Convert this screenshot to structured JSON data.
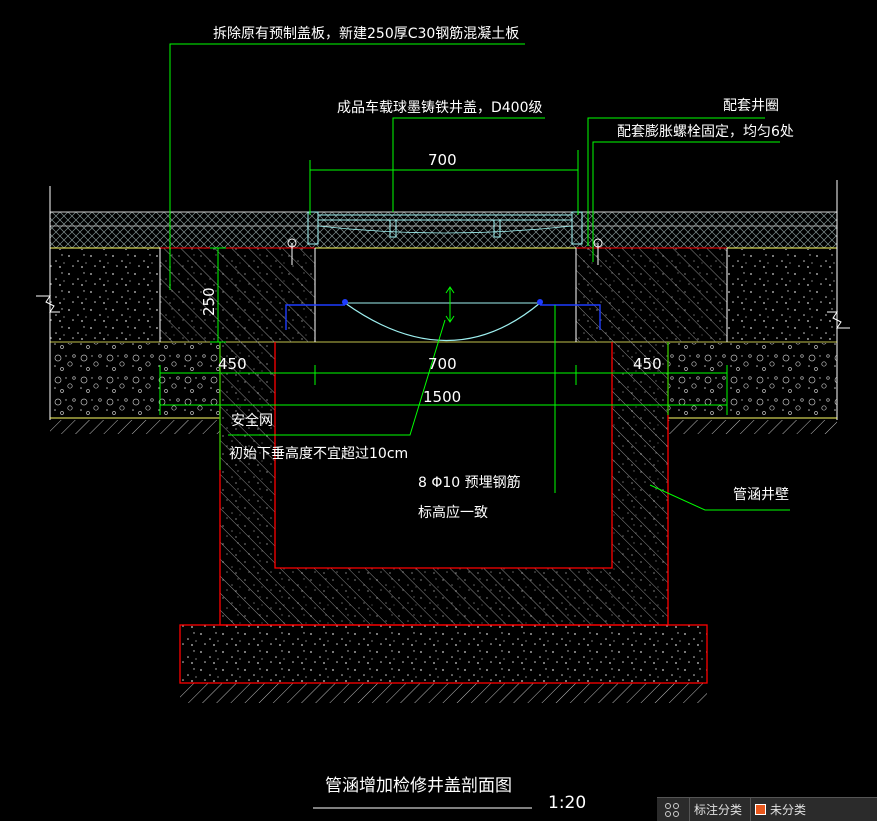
{
  "labels": {
    "demolish_note": "拆除原有预制盖板，新建250厚C30钢筋混凝土板",
    "cover_note": "成品车载球墨铸铁井盖，D400级",
    "ring_note": "配套井圈",
    "bolt_note": "配套膨胀螺栓固定，均匀6处",
    "safety_net": "安全网",
    "sag_note": "初始下垂高度不宜超过10cm",
    "rebar_note": "8 Φ10 预埋钢筋",
    "elevation_note": "标高应一致",
    "wall_note": "管涵井壁"
  },
  "dimensions": {
    "top_opening": "700",
    "slab_thickness": "250",
    "left_width": "450",
    "middle_width": "700",
    "right_width": "450",
    "total_width": "1500"
  },
  "title": {
    "text": "管涵增加检修井盖剖面图",
    "scale": "1:20"
  },
  "statusbar": {
    "annotation_label": "标注分类",
    "category_label": "未分类",
    "category_color": "#e8571c"
  },
  "colors": {
    "background": "#000000",
    "leader": "#00ff00",
    "outline_red": "#ff0000",
    "cover_cyan": "#9ef0f0",
    "rebar_blue": "#1e3cff",
    "pavement_yellow": "#ffff66",
    "hatch_grey": "#8c8c8c"
  }
}
